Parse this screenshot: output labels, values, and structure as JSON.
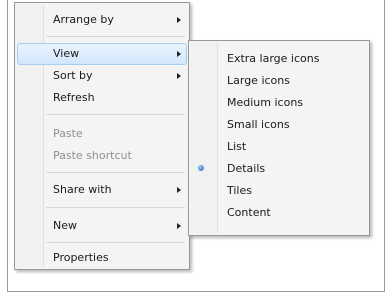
{
  "context_menu": {
    "items": [
      {
        "label": "Arrange by",
        "submenu": true
      },
      {
        "label": "View",
        "submenu": true,
        "highlighted": true
      },
      {
        "label": "Sort by",
        "submenu": true
      },
      {
        "label": "Refresh"
      },
      {
        "label": "Paste",
        "disabled": true
      },
      {
        "label": "Paste shortcut",
        "disabled": true
      },
      {
        "label": "Share with",
        "submenu": true
      },
      {
        "label": "New",
        "submenu": true
      },
      {
        "label": "Properties"
      }
    ]
  },
  "view_submenu": {
    "items": [
      {
        "label": "Extra large icons"
      },
      {
        "label": "Large icons"
      },
      {
        "label": "Medium icons"
      },
      {
        "label": "Small icons"
      },
      {
        "label": "List"
      },
      {
        "label": "Details",
        "selected": true
      },
      {
        "label": "Tiles"
      },
      {
        "label": "Content"
      }
    ]
  },
  "colors": {
    "highlight": "#d2e6fb",
    "highlight_border": "#a9cdf2",
    "disabled_text": "#8f8f8f",
    "radio_dot": "#1d5fb0"
  }
}
